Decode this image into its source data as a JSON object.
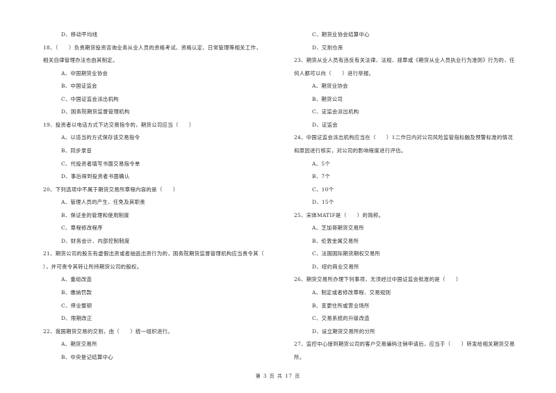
{
  "left_column": [
    {
      "type": "option",
      "text": "D、移动平均线"
    },
    {
      "type": "question",
      "text": "18、（　　）负责期货投资咨询业务从业人员的资格考试、资格认定、日常管理等相关工作，"
    },
    {
      "type": "question",
      "text": "相关自律管理办法也由其制定。"
    },
    {
      "type": "option",
      "text": "A、中国期货业协会"
    },
    {
      "type": "option",
      "text": "B、中国证监会"
    },
    {
      "type": "option",
      "text": "C、中国证监会派出机构"
    },
    {
      "type": "option",
      "text": "D、国务院期货监督管理机构"
    },
    {
      "type": "question",
      "text": "19、投资者以电话方式下达交易指令的，期货公司应当（　　）"
    },
    {
      "type": "option",
      "text": "A、以适当的方式保存该交易指令"
    },
    {
      "type": "option",
      "text": "B、同步录音"
    },
    {
      "type": "option",
      "text": "C、代投资者填写书面交易指令单"
    },
    {
      "type": "option",
      "text": "D、事后得到投资者书面确认"
    },
    {
      "type": "question",
      "text": "20、下列选项中不属于期货交易所章程内容的是（　　）"
    },
    {
      "type": "option",
      "text": "A、管理人员的产生、任免及其职责"
    },
    {
      "type": "option",
      "text": "B、保证金的管理和使用制度"
    },
    {
      "type": "option",
      "text": "C、章程修改程序"
    },
    {
      "type": "option",
      "text": "D、财务会计、内部控制制度"
    },
    {
      "type": "question",
      "text": "21、期货公司的股东有虚假出资或者抽逃出资行为的，国务院期货监督管理机构应当责令其（"
    },
    {
      "type": "question",
      "text": "），并可责令其转让所持期货公司的股权。"
    },
    {
      "type": "option",
      "text": "A、重组改造"
    },
    {
      "type": "option",
      "text": "B、缴纳罚款"
    },
    {
      "type": "option",
      "text": "C、停业整顿"
    },
    {
      "type": "option",
      "text": "D、限期改正"
    },
    {
      "type": "question",
      "text": "22、我国期货交易的交割，由（　　）统一组织进行。"
    },
    {
      "type": "option",
      "text": "A、期货交易所"
    },
    {
      "type": "option",
      "text": "B、中央登记结算中心"
    }
  ],
  "right_column": [
    {
      "type": "option",
      "text": "C、期货业协会结算中心"
    },
    {
      "type": "option",
      "text": "D、交割仓库"
    },
    {
      "type": "question",
      "text": "23、期货从业人员有违反有关法律、法规、规章或《期货从业人员执业行为准则》行为的，任"
    },
    {
      "type": "question",
      "text": "何人都可以向（　　）进行举报。"
    },
    {
      "type": "option",
      "text": "A、期货业协会"
    },
    {
      "type": "option",
      "text": "B、期货公司"
    },
    {
      "type": "option",
      "text": "C、证监会派出机构"
    },
    {
      "type": "option",
      "text": "D、证监会"
    },
    {
      "type": "question",
      "text": "24、中国证监会派出机构应当在（　　）1二作日内对公司风险监管指标触及预警标准的情况"
    },
    {
      "type": "question",
      "text": "和原因进行核实，对公司的影响程度进行评估。"
    },
    {
      "type": "option",
      "text": "A、5个"
    },
    {
      "type": "option",
      "text": "B、7个"
    },
    {
      "type": "option",
      "text": "C、10个"
    },
    {
      "type": "option",
      "text": "D、15个"
    },
    {
      "type": "question",
      "text": "25、宋体MATIF是（　　）的简称。"
    },
    {
      "type": "option",
      "text": "A、芝加哥期货交易所"
    },
    {
      "type": "option",
      "text": "B、伦敦金属交易所"
    },
    {
      "type": "option",
      "text": "C、法国国际期货期权交易所"
    },
    {
      "type": "option",
      "text": "D、纽约商业交易所"
    },
    {
      "type": "question",
      "text": "26、期货交易所办理下列事项，无须经过中国证监会批准的是（　　）"
    },
    {
      "type": "option",
      "text": "A、制定或者修改章程、交易规则"
    },
    {
      "type": "option",
      "text": "B、变更住所或营业场所"
    },
    {
      "type": "option",
      "text": "C、交易系统的升级改造"
    },
    {
      "type": "option",
      "text": "D、设立期货交易所的分所"
    },
    {
      "type": "question",
      "text": "27、监控中心接到期货公司的客户交易编码注销申请后，应当于（　　）转发给相关期货交易"
    },
    {
      "type": "question",
      "text": "所。"
    }
  ],
  "footer": {
    "page_label": "第 3 页 共 17 页"
  }
}
